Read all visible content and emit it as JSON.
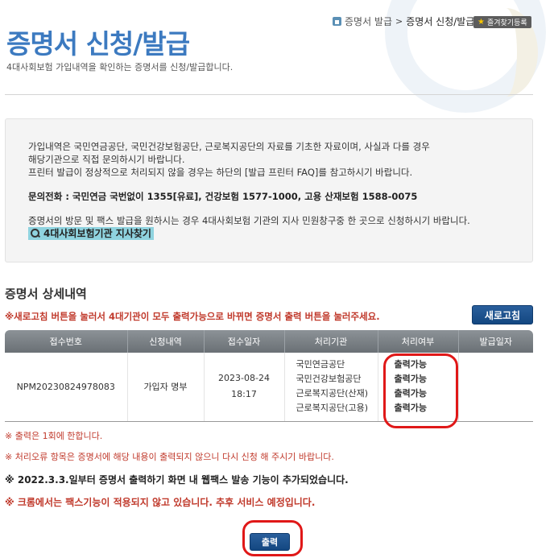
{
  "breadcrumb": {
    "parent": "증명서 발급",
    "separator": ">",
    "current": "증명서 신청/발급"
  },
  "favorites_button": {
    "label": "즐겨찾기등록"
  },
  "page": {
    "title": "증명서 신청/발급",
    "description": "4대사회보험 가입내역을 확인하는 증명서를 신청/발급합니다."
  },
  "info": {
    "line1": "가입내역은 국민연금공단, 국민건강보험공단, 근로복지공단의 자료를 기초한 자료이며, 사실과 다를 경우",
    "line2": "해당기관으로 직접 문의하시기 바랍니다.",
    "line3": "프린터 발급이 정상적으로 처리되지 않을 경우는 하단의 [발급 프린터 FAQ]를 참고하시기 바랍니다.",
    "phone": "문의전화 : 국민연금 국번없이 1355[유료], 건강보험 1577-1000, 고용 산재보험 1588-0075",
    "visit": "증명서의 방문 및 팩스 발급을 원하시는 경우 4대사회보험 기관의 지사 민원창구중 한 곳으로 신청하시기 바랍니다.",
    "branch_link": "4대사회보험기관 지사찾기"
  },
  "section": {
    "title": "증명서 상세내역",
    "refresh_note": "※새로고침 버튼을 눌러서 4대기관이 모두 출력가능으로 바뀌면 증명서 출력 버튼을 눌러주세요.",
    "refresh_button": "새로고침"
  },
  "table": {
    "headers": [
      "접수번호",
      "신청내역",
      "접수일자",
      "처리기관",
      "처리여부",
      "발급일자"
    ],
    "row": {
      "receipt_no": "NPM20230824978083",
      "request": "가입자 명부",
      "date": "2023-08-24",
      "time": "18:17",
      "agencies": [
        "국민연금공단",
        "국민건강보험공단",
        "근로복지공단(산재)",
        "근로복지공단(고용)"
      ],
      "statuses": [
        "출력가능",
        "출력가능",
        "출력가능",
        "출력가능"
      ],
      "issue_date": ""
    }
  },
  "notes": {
    "n1": "※ 출력은 1회에 한합니다.",
    "n2": "※ 처리오류 항목은 증명서에 해당 내용이 출력되지 않으니 다시 신청 해 주시기 바랍니다.",
    "n3": "※ 2022.3.3.일부터 증명서 출력하기 화면 내 웹팩스 발송 기능이 추가되었습니다.",
    "n4": "※ 크롬에서는 팩스기능이 적용되지 않고 있습니다. 추후 서비스 예정입니다."
  },
  "print_button": {
    "label": "출력"
  },
  "colors": {
    "title_blue": "#3c7ac0",
    "button_navy": "#134781",
    "warning_red": "#c0392b",
    "highlight_red": "#e01818"
  }
}
